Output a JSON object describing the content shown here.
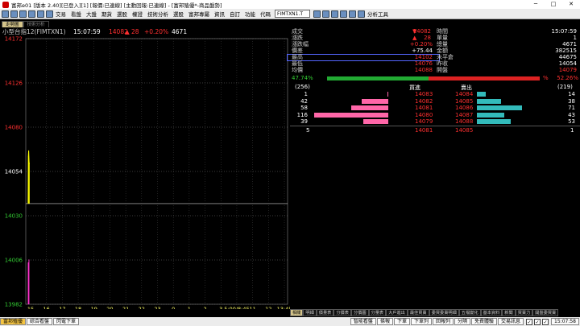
{
  "window": {
    "title": "富邦e01 [版本 2.40][已登入][1] [報價:已連線] [主動回報:已連線] - [富邦殖優*-商品盤勢]",
    "minimize": "─",
    "maximize": "□",
    "close": "✕"
  },
  "menu": {
    "items": [
      "交易",
      "看盤",
      "大盤",
      "期貨",
      "選股",
      "權證",
      "技術分析",
      "選股",
      "富邦專屬",
      "資訊",
      "自訂",
      "功能"
    ],
    "code_label": "代碼",
    "code_value": "FIMTXN1.T",
    "analysis_label": "分析工具"
  },
  "tabs": [
    {
      "label": "走勢圖",
      "active": true
    },
    {
      "label": "技術分析",
      "active": false
    }
  ],
  "chart_header": {
    "name": "小型台指12(FIMTXN1)",
    "time": "15:07:59",
    "price": "14082",
    "arrow": "▲",
    "change": "28",
    "percent": "+0.20%",
    "volume": "4671"
  },
  "chart_data": {
    "type": "line",
    "y_ticks": [
      "14172",
      "14126",
      "14080",
      "14054",
      "14030",
      "14006",
      "13982"
    ],
    "x_ticks": [
      "15",
      "16",
      "17",
      "18",
      "19",
      "20",
      "21",
      "22",
      "23",
      "0",
      "1",
      "2",
      "3",
      "5:00/8:45",
      "11",
      "12",
      "13:45"
    ],
    "ylim": [
      13982,
      14172
    ],
    "reference": 14054,
    "price_series": [
      {
        "t": 0.3,
        "v": 14054
      },
      {
        "t": 0.4,
        "v": 14088
      },
      {
        "t": 0.55,
        "v": 14092
      },
      {
        "t": 0.7,
        "v": 14084
      },
      {
        "t": 0.85,
        "v": 14082
      }
    ],
    "volume_series": [
      {
        "t": 0.35,
        "v": 14012
      },
      {
        "t": 0.5,
        "v": 13988
      },
      {
        "t": 0.65,
        "v": 14014
      }
    ],
    "colors": {
      "price": "#ffff00",
      "volume": "#ff33cc",
      "grid": "#ffffff",
      "axis": "#ffffff"
    }
  },
  "quote": {
    "left": [
      {
        "label": "成交",
        "value": "14082",
        "arrow": "▼",
        "color": "#ff3030"
      },
      {
        "label": "漲跌",
        "value": "28",
        "arrow": "▲",
        "color": "#ff3030"
      },
      {
        "label": "漲跌幅",
        "value": "+0.20%",
        "color": "#ff3030"
      },
      {
        "label": "價差",
        "value": "+75.44",
        "color": "#ffffff"
      },
      {
        "label": "最高",
        "value": "14102",
        "color": "#ff3030"
      },
      {
        "label": "最低",
        "value": "14076",
        "color": "#ff3030"
      },
      {
        "label": "均價",
        "value": "14088",
        "color": "#ff3030"
      }
    ],
    "right": [
      {
        "label": "時間",
        "value": "15:07:59",
        "color": "#ffffff"
      },
      {
        "label": "單量",
        "value": "1",
        "color": "#ffffff"
      },
      {
        "label": "總量",
        "value": "4671",
        "color": "#ffffff"
      },
      {
        "label": "金額",
        "value": "382515",
        "color": "#ffffff"
      },
      {
        "label": "未平倉",
        "value": "44675",
        "color": "#ffffff"
      },
      {
        "label": "昨收",
        "value": "14054",
        "color": "#ffffff"
      },
      {
        "label": "開盤",
        "value": "14079",
        "color": "#ff3030"
      }
    ],
    "buy_ratio": "47.74%",
    "sell_ratio": "52.26%",
    "buy_ratio_value": 0.4774,
    "pct_sign": "%"
  },
  "book": {
    "bid_total": "(256)",
    "bid_label": "買進",
    "ask_label": "賣出",
    "ask_total": "(219)",
    "rows": [
      {
        "bid_qty": "1",
        "bid_price": "14083",
        "ask_price": "14084",
        "ask_qty": "14",
        "bid_n": 1,
        "ask_n": 14
      },
      {
        "bid_qty": "42",
        "bid_price": "14082",
        "ask_price": "14085",
        "ask_qty": "38",
        "bid_n": 42,
        "ask_n": 38
      },
      {
        "bid_qty": "58",
        "bid_price": "14081",
        "ask_price": "14086",
        "ask_qty": "71",
        "bid_n": 58,
        "ask_n": 71
      },
      {
        "bid_qty": "116",
        "bid_price": "14080",
        "ask_price": "14087",
        "ask_qty": "43",
        "bid_n": 116,
        "ask_n": 43
      },
      {
        "bid_qty": "39",
        "bid_price": "14079",
        "ask_price": "14088",
        "ask_qty": "53",
        "bid_n": 39,
        "ask_n": 53
      }
    ],
    "last": {
      "bid_qty": "5",
      "bid_price": "14081",
      "ask_price": "14085",
      "ask_qty": "1"
    }
  },
  "bottom_tabs": [
    "相關",
    "明細",
    "價量表",
    "分價表",
    "分價圖",
    "分量表",
    "大戶進出",
    "最佳買賣",
    "委買委賣明細",
    "五檔變化",
    "基本資料",
    "新聞",
    "買賣力",
    "開盤委買賣"
  ],
  "status": {
    "left": [
      "富邦殖優",
      "綜合看盤",
      "閃電下單"
    ],
    "right": [
      "智能看盤",
      "條報",
      "下單",
      "下單列",
      "回報列",
      "分隔",
      "免費體驗",
      "交易訊息"
    ],
    "clock": "15:07:58"
  }
}
